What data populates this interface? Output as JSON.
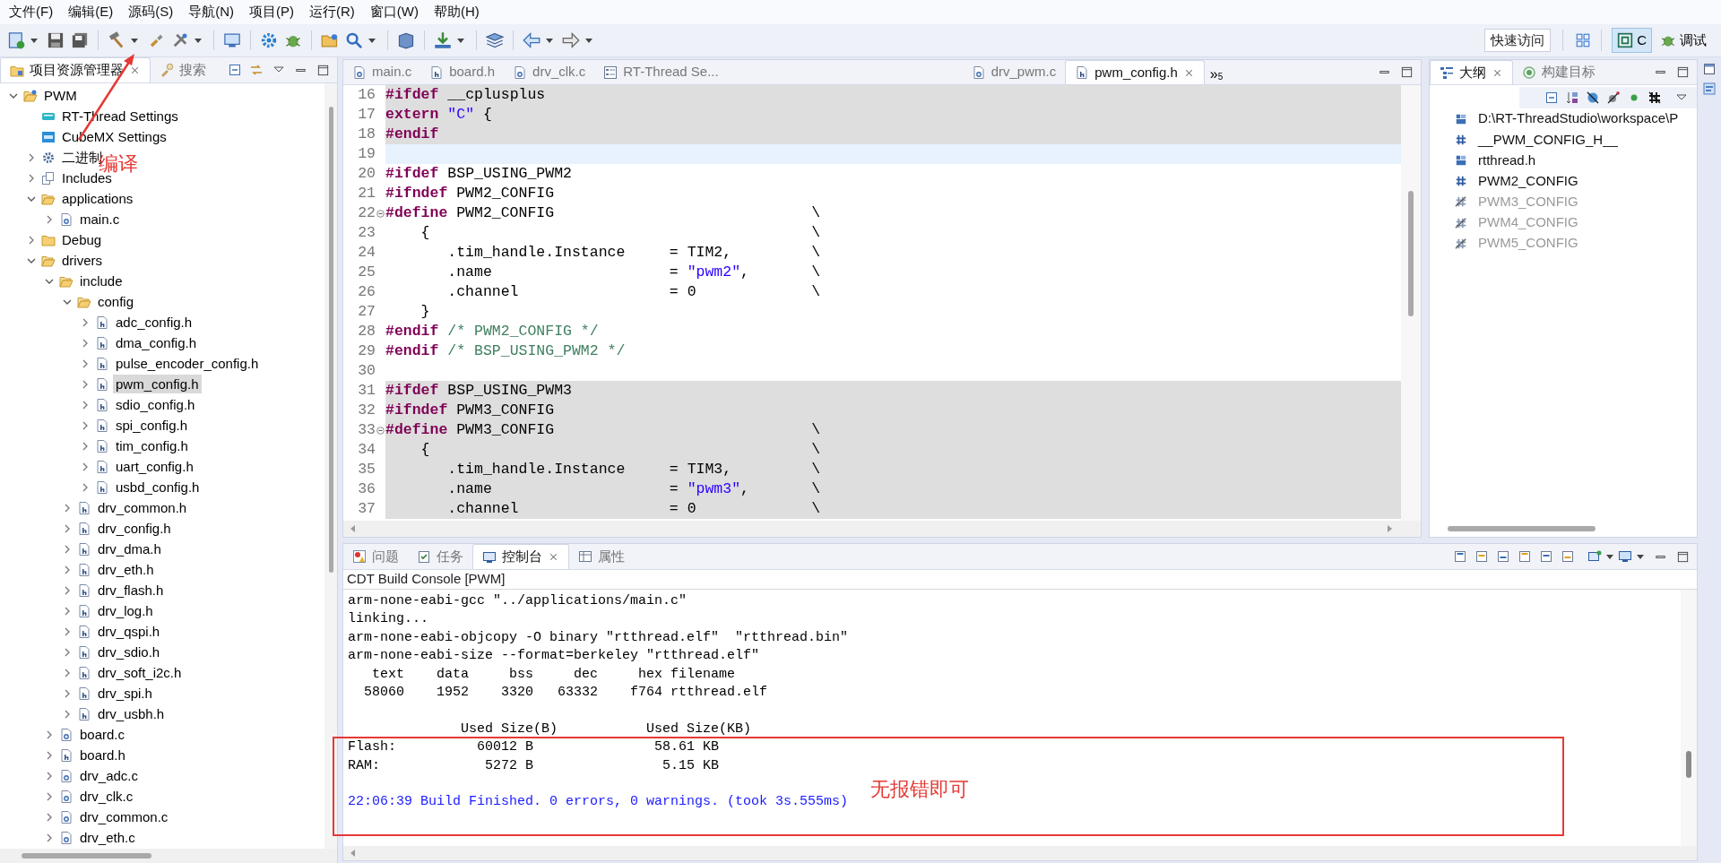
{
  "menu": [
    "文件(F)",
    "编辑(E)",
    "源码(S)",
    "导航(N)",
    "项目(P)",
    "运行(R)",
    "窗口(W)",
    "帮助(H)"
  ],
  "toolbar": {
    "quick_access": "快速访问",
    "perspectives": [
      {
        "kind": "c",
        "label": "C",
        "selected": true
      },
      {
        "kind": "debug",
        "label": "调试",
        "selected": false
      }
    ]
  },
  "explorer": {
    "tabs": [
      {
        "kind": "explorer",
        "label": "项目资源管理器",
        "selected": true
      },
      {
        "kind": "search",
        "label": "搜索",
        "selected": false
      }
    ],
    "tree": [
      {
        "kind": "project",
        "label": "PWM",
        "expanded": true,
        "selected": false,
        "children": [
          {
            "kind": "rt",
            "label": "RT-Thread Settings",
            "selected": false
          },
          {
            "kind": "mx",
            "label": "CubeMX Settings",
            "selected": false
          },
          {
            "kind": "binary",
            "label": "二进制",
            "expanded": false,
            "selected": false
          },
          {
            "kind": "includes",
            "label": "Includes",
            "expanded": false,
            "selected": false
          },
          {
            "kind": "folder",
            "label": "applications",
            "expanded": true,
            "selected": false,
            "children": [
              {
                "kind": "c",
                "label": "main.c",
                "expanded": false,
                "selected": false
              }
            ]
          },
          {
            "kind": "folder",
            "label": "Debug",
            "expanded": false,
            "selected": false
          },
          {
            "kind": "folder",
            "label": "drivers",
            "expanded": true,
            "selected": false,
            "children": [
              {
                "kind": "folder",
                "label": "include",
                "expanded": true,
                "selected": false,
                "children": [
                  {
                    "kind": "folder",
                    "label": "config",
                    "expanded": true,
                    "selected": false,
                    "children": [
                      {
                        "kind": "h",
                        "label": "adc_config.h",
                        "expanded": false,
                        "selected": false
                      },
                      {
                        "kind": "h",
                        "label": "dma_config.h",
                        "expanded": false,
                        "selected": false
                      },
                      {
                        "kind": "h",
                        "label": "pulse_encoder_config.h",
                        "expanded": false,
                        "selected": false
                      },
                      {
                        "kind": "h",
                        "label": "pwm_config.h",
                        "expanded": false,
                        "selected": true
                      },
                      {
                        "kind": "h",
                        "label": "sdio_config.h",
                        "expanded": false,
                        "selected": false
                      },
                      {
                        "kind": "h",
                        "label": "spi_config.h",
                        "expanded": false,
                        "selected": false
                      },
                      {
                        "kind": "h",
                        "label": "tim_config.h",
                        "expanded": false,
                        "selected": false
                      },
                      {
                        "kind": "h",
                        "label": "uart_config.h",
                        "expanded": false,
                        "selected": false
                      },
                      {
                        "kind": "h",
                        "label": "usbd_config.h",
                        "expanded": false,
                        "selected": false
                      }
                    ]
                  },
                  {
                    "kind": "h",
                    "label": "drv_common.h",
                    "expanded": false,
                    "selected": false
                  },
                  {
                    "kind": "h",
                    "label": "drv_config.h",
                    "expanded": false,
                    "selected": false
                  },
                  {
                    "kind": "h",
                    "label": "drv_dma.h",
                    "expanded": false,
                    "selected": false
                  },
                  {
                    "kind": "h",
                    "label": "drv_eth.h",
                    "expanded": false,
                    "selected": false
                  },
                  {
                    "kind": "h",
                    "label": "drv_flash.h",
                    "expanded": false,
                    "selected": false
                  },
                  {
                    "kind": "h",
                    "label": "drv_log.h",
                    "expanded": false,
                    "selected": false
                  },
                  {
                    "kind": "h",
                    "label": "drv_qspi.h",
                    "expanded": false,
                    "selected": false
                  },
                  {
                    "kind": "h",
                    "label": "drv_sdio.h",
                    "expanded": false,
                    "selected": false
                  },
                  {
                    "kind": "h",
                    "label": "drv_soft_i2c.h",
                    "expanded": false,
                    "selected": false
                  },
                  {
                    "kind": "h",
                    "label": "drv_spi.h",
                    "expanded": false,
                    "selected": false
                  },
                  {
                    "kind": "h",
                    "label": "drv_usbh.h",
                    "expanded": false,
                    "selected": false
                  }
                ]
              },
              {
                "kind": "c",
                "label": "board.c",
                "expanded": false,
                "selected": false
              },
              {
                "kind": "h",
                "label": "board.h",
                "expanded": false,
                "selected": false
              },
              {
                "kind": "c",
                "label": "drv_adc.c",
                "expanded": false,
                "selected": false
              },
              {
                "kind": "c",
                "label": "drv_clk.c",
                "expanded": false,
                "selected": false
              },
              {
                "kind": "c",
                "label": "drv_common.c",
                "expanded": false,
                "selected": false
              },
              {
                "kind": "c",
                "label": "drv_eth.c",
                "expanded": false,
                "selected": false
              }
            ]
          }
        ]
      }
    ]
  },
  "editor": {
    "tabs": [
      {
        "kind": "c",
        "label": "main.c",
        "selected": false
      },
      {
        "kind": "h",
        "label": "board.h",
        "selected": false
      },
      {
        "kind": "c",
        "label": "drv_clk.c",
        "selected": false
      },
      {
        "kind": "settings",
        "label": "RT-Thread Se...",
        "selected": false
      },
      {
        "kind": "c",
        "label": "drv_pwm.c",
        "selected": false
      },
      {
        "kind": "h",
        "label": "pwm_config.h",
        "selected": true
      }
    ],
    "overflow": {
      "marker": "»",
      "count": "5"
    },
    "lines": [
      {
        "number": "16",
        "kind": "inactive",
        "fold": false,
        "tokens": [
          {
            "kind": "directive",
            "text": "#ifdef"
          },
          {
            "kind": "plain",
            "text": " __cplusplus"
          }
        ]
      },
      {
        "number": "17",
        "kind": "inactive",
        "fold": false,
        "tokens": [
          {
            "kind": "keyword",
            "text": "extern"
          },
          {
            "kind": "string",
            "text": " \"C\""
          },
          {
            "kind": "plain",
            "text": " {"
          }
        ]
      },
      {
        "number": "18",
        "kind": "inactive",
        "fold": false,
        "tokens": [
          {
            "kind": "directive",
            "text": "#endif"
          }
        ]
      },
      {
        "number": "19",
        "kind": "current",
        "fold": false
      },
      {
        "number": "20",
        "kind": "normal",
        "fold": false,
        "tokens": [
          {
            "kind": "directive",
            "text": "#ifdef"
          },
          {
            "kind": "plain",
            "text": " BSP_USING_PWM2"
          }
        ]
      },
      {
        "number": "21",
        "kind": "normal",
        "fold": false,
        "tokens": [
          {
            "kind": "directive",
            "text": "#ifndef"
          },
          {
            "kind": "plain",
            "text": " PWM2_CONFIG"
          }
        ]
      },
      {
        "number": "22",
        "kind": "normal",
        "fold": true,
        "tokens": [
          {
            "kind": "directive",
            "text": "#define"
          },
          {
            "kind": "plain",
            "text": " PWM2_CONFIG                             \\"
          }
        ]
      },
      {
        "number": "23",
        "kind": "normal",
        "fold": false,
        "tokens": [
          {
            "kind": "plain",
            "text": "    {                                           \\"
          }
        ]
      },
      {
        "number": "24",
        "kind": "normal",
        "fold": false,
        "tokens": [
          {
            "kind": "plain",
            "text": "       .tim_handle.Instance     = TIM2,         \\"
          }
        ]
      },
      {
        "number": "25",
        "kind": "normal",
        "fold": false,
        "tokens": [
          {
            "kind": "plain",
            "text": "       .name                    = "
          },
          {
            "kind": "string",
            "text": "\"pwm2\""
          },
          {
            "kind": "plain",
            "text": ",       \\"
          }
        ]
      },
      {
        "number": "26",
        "kind": "normal",
        "fold": false,
        "tokens": [
          {
            "kind": "plain",
            "text": "       .channel                 = 0             \\"
          }
        ]
      },
      {
        "number": "27",
        "kind": "normal",
        "fold": false,
        "tokens": [
          {
            "kind": "plain",
            "text": "    }"
          }
        ]
      },
      {
        "number": "28",
        "kind": "normal",
        "fold": false,
        "tokens": [
          {
            "kind": "directive",
            "text": "#endif"
          },
          {
            "kind": "comment",
            "text": " /* PWM2_CONFIG */"
          }
        ]
      },
      {
        "number": "29",
        "kind": "normal",
        "fold": false,
        "tokens": [
          {
            "kind": "directive",
            "text": "#endif"
          },
          {
            "kind": "comment",
            "text": " /* BSP_USING_PWM2 */"
          }
        ]
      },
      {
        "number": "30",
        "kind": "normal",
        "fold": false
      },
      {
        "number": "31",
        "kind": "inactive",
        "fold": false,
        "tokens": [
          {
            "kind": "directive",
            "text": "#ifdef"
          },
          {
            "kind": "plain",
            "text": " BSP_USING_PWM3"
          }
        ]
      },
      {
        "number": "32",
        "kind": "inactive",
        "fold": false,
        "tokens": [
          {
            "kind": "directive",
            "text": "#ifndef"
          },
          {
            "kind": "plain",
            "text": " PWM3_CONFIG"
          }
        ]
      },
      {
        "number": "33",
        "kind": "inactive",
        "fold": true,
        "tokens": [
          {
            "kind": "directive",
            "text": "#define"
          },
          {
            "kind": "plain",
            "text": " PWM3_CONFIG                             \\"
          }
        ]
      },
      {
        "number": "34",
        "kind": "inactive",
        "fold": false,
        "tokens": [
          {
            "kind": "plain",
            "text": "    {                                           \\"
          }
        ]
      },
      {
        "number": "35",
        "kind": "inactive",
        "fold": false,
        "tokens": [
          {
            "kind": "plain",
            "text": "       .tim_handle.Instance     = TIM3,         \\"
          }
        ]
      },
      {
        "number": "36",
        "kind": "inactive",
        "fold": false,
        "tokens": [
          {
            "kind": "plain",
            "text": "       .name                    = "
          },
          {
            "kind": "string",
            "text": "\"pwm3\""
          },
          {
            "kind": "plain",
            "text": ",       \\"
          }
        ]
      },
      {
        "number": "37",
        "kind": "inactive",
        "fold": false,
        "tokens": [
          {
            "kind": "plain",
            "text": "       .channel                 = 0             \\"
          }
        ]
      }
    ]
  },
  "outline": {
    "tabs": [
      {
        "kind": "outline",
        "label": "大纲",
        "selected": true
      },
      {
        "kind": "target",
        "label": "构建目标",
        "selected": false
      }
    ],
    "items": [
      {
        "kind": "include",
        "label": "D:\\RT-ThreadStudio\\workspace\\P",
        "disabled": false
      },
      {
        "kind": "macro",
        "label": "__PWM_CONFIG_H__",
        "disabled": false
      },
      {
        "kind": "include",
        "label": "rtthread.h",
        "disabled": false
      },
      {
        "kind": "macro",
        "label": "PWM2_CONFIG",
        "disabled": false
      },
      {
        "kind": "macro",
        "label": "PWM3_CONFIG",
        "disabled": true
      },
      {
        "kind": "macro",
        "label": "PWM4_CONFIG",
        "disabled": true
      },
      {
        "kind": "macro",
        "label": "PWM5_CONFIG",
        "disabled": true
      }
    ]
  },
  "console": {
    "tabs": [
      {
        "kind": "problems",
        "label": "问题",
        "selected": false
      },
      {
        "kind": "tasks",
        "label": "任务",
        "selected": false
      },
      {
        "kind": "console",
        "label": "控制台",
        "selected": true
      },
      {
        "kind": "properties",
        "label": "属性",
        "selected": false
      }
    ],
    "title": "CDT Build Console [PWM]",
    "lines": [
      {
        "kind": "output",
        "text": "arm-none-eabi-gcc \"../applications/main.c\""
      },
      {
        "kind": "output",
        "text": "linking..."
      },
      {
        "kind": "output",
        "text": "arm-none-eabi-objcopy -O binary \"rtthread.elf\"  \"rtthread.bin\""
      },
      {
        "kind": "output",
        "text": "arm-none-eabi-size --format=berkeley \"rtthread.elf\""
      },
      {
        "kind": "output",
        "text": "   text    data     bss     dec     hex filename"
      },
      {
        "kind": "output",
        "text": "  58060    1952    3320   63332    f764 rtthread.elf"
      },
      {
        "kind": "blank"
      },
      {
        "kind": "output",
        "text": "              Used Size(B)           Used Size(KB)"
      },
      {
        "kind": "output",
        "text": "Flash:          60012 B               58.61 KB"
      },
      {
        "kind": "output",
        "text": "RAM:             5272 B                5.15 KB"
      },
      {
        "kind": "blank"
      },
      {
        "kind": "finished",
        "text": "22:06:39 Build Finished. 0 errors, 0 warnings. (took 3s.555ms)"
      }
    ]
  },
  "annotations": [
    {
      "kind": "arrow-label",
      "text": "编译"
    },
    {
      "kind": "box-note",
      "text": "无报错即可"
    }
  ]
}
